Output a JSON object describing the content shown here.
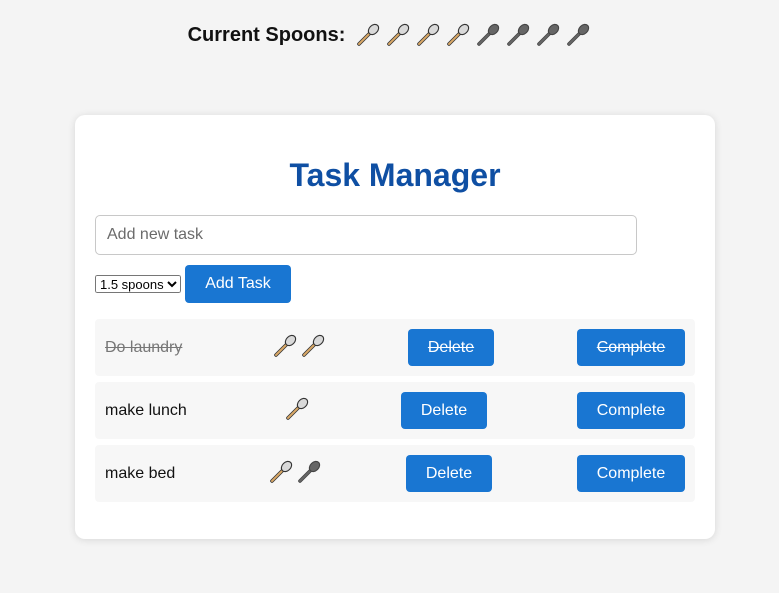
{
  "header": {
    "spoons_label": "Current Spoons:",
    "spoons_total": 8,
    "spoons_used": 4,
    "spoon_icon": "spoon-icon"
  },
  "main": {
    "title": "Task Manager",
    "new_task": {
      "placeholder": "Add new task",
      "value": ""
    },
    "spoon_select": {
      "selected": "1.5 spoons"
    },
    "add_button_label": "Add Task",
    "tasks": [
      {
        "name": "Do laundry",
        "spoons": 2,
        "completed": true,
        "delete_label": "Delete",
        "complete_label": "Complete"
      },
      {
        "name": "make lunch",
        "spoons": 1,
        "completed": false,
        "delete_label": "Delete",
        "complete_label": "Complete"
      },
      {
        "name": "make bed",
        "spoons": 1.5,
        "completed": false,
        "delete_label": "Delete",
        "complete_label": "Complete"
      }
    ]
  },
  "colors": {
    "accent": "#1976d2",
    "title": "#0f4fa3",
    "spoon_active_handle": "#d9a867",
    "spoon_spent": "#666666",
    "background": "#f4f4f4"
  }
}
